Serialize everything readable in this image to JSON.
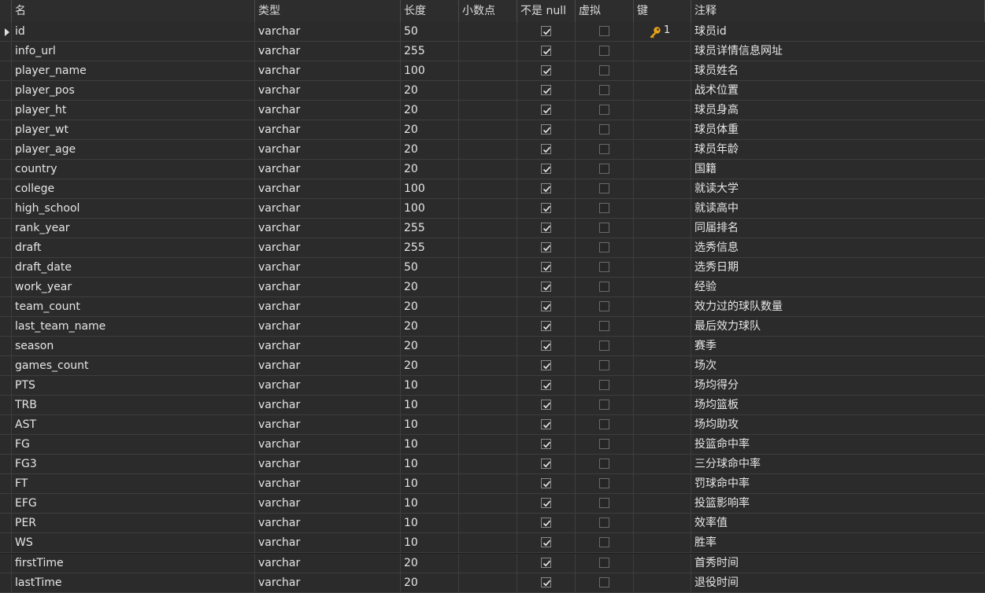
{
  "columns": {
    "name": "名",
    "type": "类型",
    "length": "长度",
    "decimal": "小数点",
    "not_null": "不是 null",
    "virtual": "虚拟",
    "key": "键",
    "comment": "注释"
  },
  "rows": [
    {
      "name": "id",
      "type": "varchar",
      "length": "50",
      "not_null": true,
      "virtual": false,
      "key": "1",
      "comment": "球员id"
    },
    {
      "name": "info_url",
      "type": "varchar",
      "length": "255",
      "not_null": true,
      "virtual": false,
      "key": "",
      "comment": "球员详情信息网址"
    },
    {
      "name": "player_name",
      "type": "varchar",
      "length": "100",
      "not_null": true,
      "virtual": false,
      "key": "",
      "comment": "球员姓名"
    },
    {
      "name": "player_pos",
      "type": "varchar",
      "length": "20",
      "not_null": true,
      "virtual": false,
      "key": "",
      "comment": "战术位置"
    },
    {
      "name": "player_ht",
      "type": "varchar",
      "length": "20",
      "not_null": true,
      "virtual": false,
      "key": "",
      "comment": "球员身高"
    },
    {
      "name": "player_wt",
      "type": "varchar",
      "length": "20",
      "not_null": true,
      "virtual": false,
      "key": "",
      "comment": "球员体重"
    },
    {
      "name": "player_age",
      "type": "varchar",
      "length": "20",
      "not_null": true,
      "virtual": false,
      "key": "",
      "comment": "球员年龄"
    },
    {
      "name": "country",
      "type": "varchar",
      "length": "20",
      "not_null": true,
      "virtual": false,
      "key": "",
      "comment": "国籍"
    },
    {
      "name": "college",
      "type": "varchar",
      "length": "100",
      "not_null": true,
      "virtual": false,
      "key": "",
      "comment": "就读大学"
    },
    {
      "name": "high_school",
      "type": "varchar",
      "length": "100",
      "not_null": true,
      "virtual": false,
      "key": "",
      "comment": "就读高中"
    },
    {
      "name": "rank_year",
      "type": "varchar",
      "length": "255",
      "not_null": true,
      "virtual": false,
      "key": "",
      "comment": "同届排名"
    },
    {
      "name": "draft",
      "type": "varchar",
      "length": "255",
      "not_null": true,
      "virtual": false,
      "key": "",
      "comment": "选秀信息"
    },
    {
      "name": "draft_date",
      "type": "varchar",
      "length": "50",
      "not_null": true,
      "virtual": false,
      "key": "",
      "comment": "选秀日期"
    },
    {
      "name": "work_year",
      "type": "varchar",
      "length": "20",
      "not_null": true,
      "virtual": false,
      "key": "",
      "comment": "经验"
    },
    {
      "name": "team_count",
      "type": "varchar",
      "length": "20",
      "not_null": true,
      "virtual": false,
      "key": "",
      "comment": "效力过的球队数量"
    },
    {
      "name": "last_team_name",
      "type": "varchar",
      "length": "20",
      "not_null": true,
      "virtual": false,
      "key": "",
      "comment": "最后效力球队"
    },
    {
      "name": "season",
      "type": "varchar",
      "length": "20",
      "not_null": true,
      "virtual": false,
      "key": "",
      "comment": "赛季"
    },
    {
      "name": "games_count",
      "type": "varchar",
      "length": "20",
      "not_null": true,
      "virtual": false,
      "key": "",
      "comment": "场次"
    },
    {
      "name": "PTS",
      "type": "varchar",
      "length": "10",
      "not_null": true,
      "virtual": false,
      "key": "",
      "comment": "场均得分"
    },
    {
      "name": "TRB",
      "type": "varchar",
      "length": "10",
      "not_null": true,
      "virtual": false,
      "key": "",
      "comment": "场均篮板"
    },
    {
      "name": "AST",
      "type": "varchar",
      "length": "10",
      "not_null": true,
      "virtual": false,
      "key": "",
      "comment": "场均助攻"
    },
    {
      "name": "FG",
      "type": "varchar",
      "length": "10",
      "not_null": true,
      "virtual": false,
      "key": "",
      "comment": "投篮命中率"
    },
    {
      "name": "FG3",
      "type": "varchar",
      "length": "10",
      "not_null": true,
      "virtual": false,
      "key": "",
      "comment": "三分球命中率"
    },
    {
      "name": "FT",
      "type": "varchar",
      "length": "10",
      "not_null": true,
      "virtual": false,
      "key": "",
      "comment": "罚球命中率"
    },
    {
      "name": "EFG",
      "type": "varchar",
      "length": "10",
      "not_null": true,
      "virtual": false,
      "key": "",
      "comment": "投篮影响率"
    },
    {
      "name": "PER",
      "type": "varchar",
      "length": "10",
      "not_null": true,
      "virtual": false,
      "key": "",
      "comment": "效率值"
    },
    {
      "name": "WS",
      "type": "varchar",
      "length": "10",
      "not_null": true,
      "virtual": false,
      "key": "",
      "comment": "胜率"
    },
    {
      "name": "firstTime",
      "type": "varchar",
      "length": "20",
      "not_null": true,
      "virtual": false,
      "key": "",
      "comment": "首秀时间"
    },
    {
      "name": "lastTime",
      "type": "varchar",
      "length": "20",
      "not_null": true,
      "virtual": false,
      "key": "",
      "comment": "退役时间"
    }
  ],
  "selected_row": 0,
  "icons": {
    "row_pointer": "row-pointer-icon",
    "primary_key": "primary-key-icon",
    "checkbox": "checkbox-icon"
  },
  "colors": {
    "background": "#2b2b2b",
    "grid_line": "#3e3e3e",
    "text": "#e6e6e6",
    "key_icon": "#e8a317"
  }
}
